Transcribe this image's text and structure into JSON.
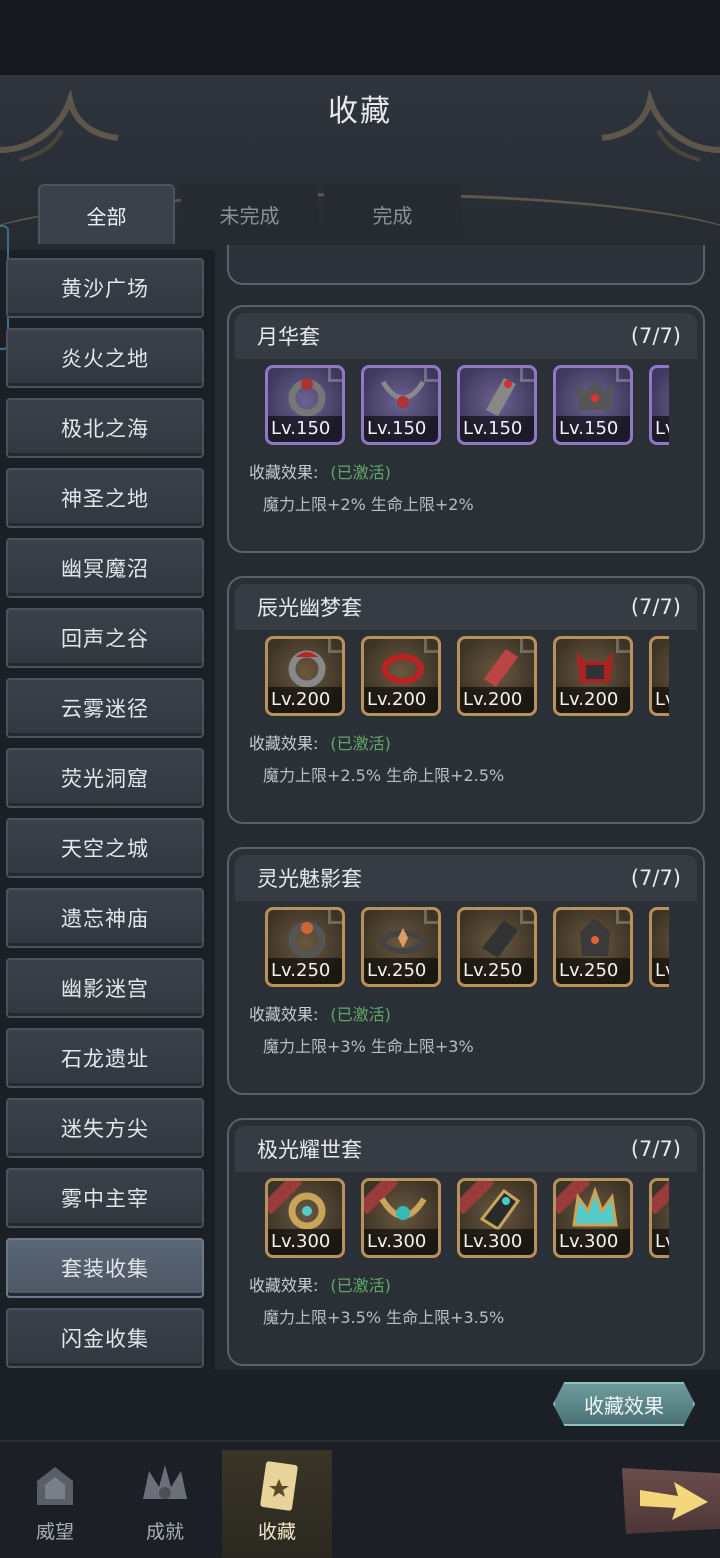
{
  "header": {
    "title": "收藏"
  },
  "tabs": [
    {
      "label": "全部"
    },
    {
      "label": "未完成"
    },
    {
      "label": "完成"
    }
  ],
  "sidebar": {
    "items": [
      {
        "label": "黄沙广场"
      },
      {
        "label": "炎火之地"
      },
      {
        "label": "极北之海"
      },
      {
        "label": "神圣之地"
      },
      {
        "label": "幽冥魔沼"
      },
      {
        "label": "回声之谷"
      },
      {
        "label": "云雾迷径"
      },
      {
        "label": "荧光洞窟"
      },
      {
        "label": "天空之城"
      },
      {
        "label": "遗忘神庙"
      },
      {
        "label": "幽影迷宫"
      },
      {
        "label": "石龙遗址"
      },
      {
        "label": "迷失方尖"
      },
      {
        "label": "雾中主宰"
      },
      {
        "label": "套装收集"
      },
      {
        "label": "闪金收集"
      }
    ],
    "active_index": 14
  },
  "sets": [
    {
      "name": "月华套",
      "progress": "(7/7)",
      "items": [
        {
          "level": "Lv.150"
        },
        {
          "level": "Lv.150"
        },
        {
          "level": "Lv.150"
        },
        {
          "level": "Lv.150"
        },
        {
          "level": "Lv"
        }
      ],
      "effect_label": "收藏效果:",
      "effect_status": "(已激活)",
      "effect_values": "魔力上限+2%  生命上限+2%"
    },
    {
      "name": "辰光幽梦套",
      "progress": "(7/7)",
      "items": [
        {
          "level": "Lv.200"
        },
        {
          "level": "Lv.200"
        },
        {
          "level": "Lv.200"
        },
        {
          "level": "Lv.200"
        },
        {
          "level": "Lv"
        }
      ],
      "effect_label": "收藏效果:",
      "effect_status": "(已激活)",
      "effect_values": "魔力上限+2.5%  生命上限+2.5%"
    },
    {
      "name": "灵光魅影套",
      "progress": "(7/7)",
      "items": [
        {
          "level": "Lv.250"
        },
        {
          "level": "Lv.250"
        },
        {
          "level": "Lv.250"
        },
        {
          "level": "Lv.250"
        },
        {
          "level": "Lv"
        }
      ],
      "effect_label": "收藏效果:",
      "effect_status": "(已激活)",
      "effect_values": "魔力上限+3%  生命上限+3%"
    },
    {
      "name": "极光耀世套",
      "progress": "(7/7)",
      "items": [
        {
          "level": "Lv.300"
        },
        {
          "level": "Lv.300"
        },
        {
          "level": "Lv.300"
        },
        {
          "level": "Lv.300"
        },
        {
          "level": "Lv"
        }
      ],
      "effect_label": "收藏效果:",
      "effect_status": "(已激活)",
      "effect_values": "魔力上限+3.5%  生命上限+3.5%"
    }
  ],
  "collect_effect_button": {
    "label": "收藏效果"
  },
  "bottom_nav": [
    {
      "label": "威望",
      "icon": "prestige-icon"
    },
    {
      "label": "成就",
      "icon": "achievement-icon"
    },
    {
      "label": "收藏",
      "icon": "collection-card-icon"
    }
  ],
  "colors": {
    "activated": "#5fa868",
    "purple_frame": "#8f79c5",
    "gold_frame": "#b7935b",
    "accent_button": "#6f9a9a"
  }
}
